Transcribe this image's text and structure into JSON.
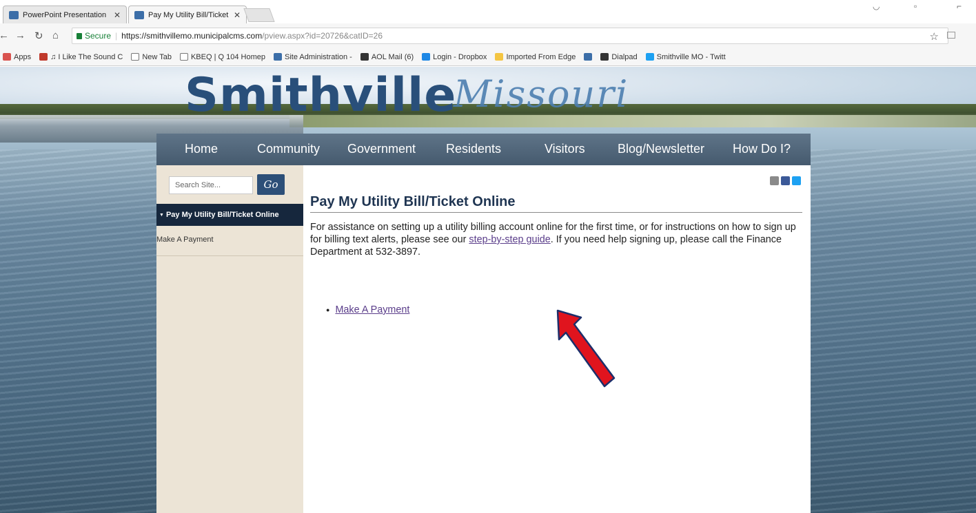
{
  "browser": {
    "tabs": [
      {
        "title": "PowerPoint Presentation",
        "active": false
      },
      {
        "title": "Pay My Utility Bill/Ticket",
        "active": true
      }
    ],
    "url": {
      "secure_label": "Secure",
      "host": "https://smithvillemo.municipalcms.com",
      "path": "/pview.aspx?id=20726&catID=26"
    },
    "bookmarks": [
      {
        "label": "Apps",
        "icon": "apps-grid-icon",
        "color": "#d9534f"
      },
      {
        "label": "♫ I Like The Sound C",
        "icon": "music-icon",
        "color": "#c0392b"
      },
      {
        "label": "New Tab",
        "icon": "page-icon",
        "color": "#ffffff"
      },
      {
        "label": "KBEQ | Q 104 Homep",
        "icon": "page-icon",
        "color": "#ffffff"
      },
      {
        "label": "Site Administration -",
        "icon": "cms-icon",
        "color": "#3c6ea8"
      },
      {
        "label": "AOL Mail (6)",
        "icon": "aol-icon",
        "color": "#333333"
      },
      {
        "label": "Login - Dropbox",
        "icon": "dropbox-icon",
        "color": "#1e88e5"
      },
      {
        "label": "Imported From Edge",
        "icon": "folder-icon",
        "color": "#f4c542"
      },
      {
        "label": "",
        "icon": "cms-icon",
        "color": "#3c6ea8"
      },
      {
        "label": "Dialpad",
        "icon": "dialpad-icon",
        "color": "#333333"
      },
      {
        "label": "Smithville MO - Twitt",
        "icon": "twitter-icon",
        "color": "#1da1f2"
      }
    ]
  },
  "site": {
    "brand": "Smithville",
    "brand_script": "Missouri",
    "nav": [
      "Home",
      "Community",
      "Government",
      "Residents",
      "Visitors",
      "Blog/Newsletter",
      "How Do I?"
    ],
    "search_placeholder": "Search Site...",
    "go_label": "Go",
    "sidebar": {
      "active": "Pay My Utility Bill/Ticket Online",
      "items": [
        "Make A Payment"
      ]
    },
    "content": {
      "title": "Pay My Utility Bill/Ticket Online",
      "para_before": "For assistance on setting up a utility billing account online for the first time, or for instructions on how to sign up for billing text alerts, please see our ",
      "para_link": "step-by-step guide",
      "para_after": ". If you need help signing up, please call the Finance Department at 532-3897.",
      "links": [
        "Make A Payment"
      ]
    }
  },
  "colors": {
    "nav_bg": "#455a6e",
    "sidebar_active_bg": "#16273d",
    "link": "#5a3d8a",
    "arrow": "#e0141e"
  }
}
